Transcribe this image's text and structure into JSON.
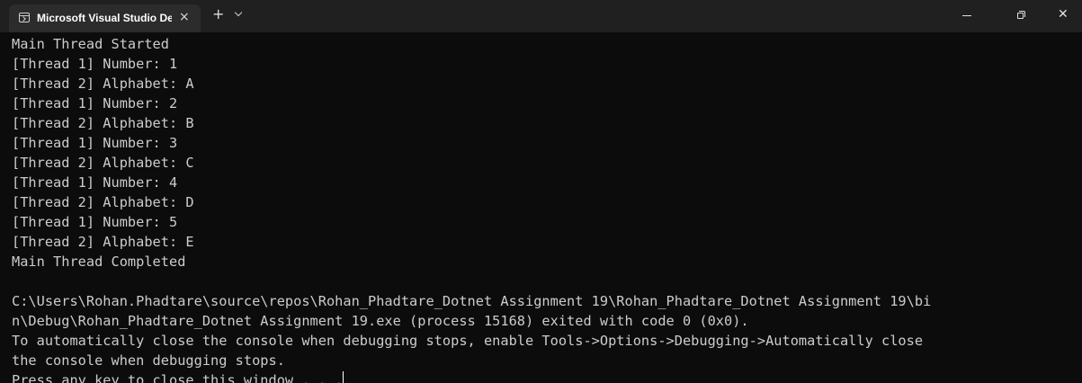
{
  "window": {
    "tab_title": "Microsoft Visual Studio Debu",
    "tab_close": "×",
    "new_tab": "+",
    "close": "✕"
  },
  "console": {
    "program_output": [
      "Main Thread Started",
      "[Thread 1] Number: 1",
      "[Thread 2] Alphabet: A",
      "[Thread 1] Number: 2",
      "[Thread 2] Alphabet: B",
      "[Thread 1] Number: 3",
      "[Thread 2] Alphabet: C",
      "[Thread 1] Number: 4",
      "[Thread 2] Alphabet: D",
      "[Thread 1] Number: 5",
      "[Thread 2] Alphabet: E",
      "Main Thread Completed"
    ],
    "exit_message": [
      "C:\\Users\\Rohan.Phadtare\\source\\repos\\Rohan_Phadtare_Dotnet Assignment 19\\Rohan_Phadtare_Dotnet Assignment 19\\bi",
      "n\\Debug\\Rohan_Phadtare_Dotnet Assignment 19.exe (process 15168) exited with code 0 (0x0).",
      "To automatically close the console when debugging stops, enable Tools->Options->Debugging->Automatically close",
      "the console when debugging stops.",
      "Press any key to close this window . . ."
    ]
  },
  "colors": {
    "background": "#0c0c0c",
    "titlebar": "#202020",
    "active_tab": "#2c2c2c",
    "text": "#cccccc"
  }
}
